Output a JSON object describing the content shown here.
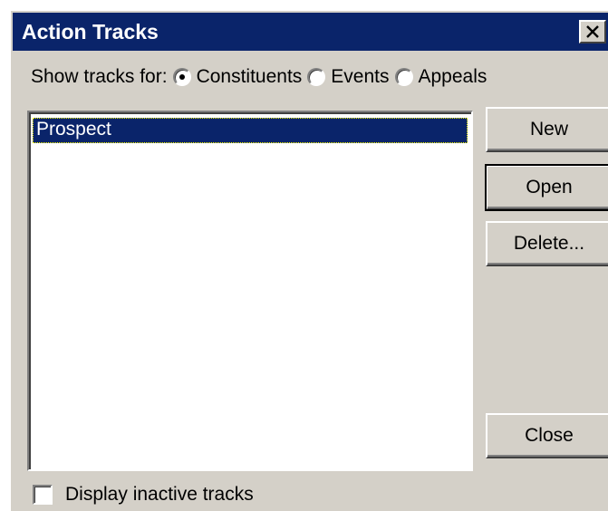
{
  "window": {
    "title": "Action Tracks"
  },
  "show_tracks": {
    "label": "Show tracks for:",
    "options": [
      {
        "label": "Constituents",
        "selected": true
      },
      {
        "label": "Events",
        "selected": false
      },
      {
        "label": "Appeals",
        "selected": false
      }
    ]
  },
  "tracks_list": {
    "items": [
      "Prospect"
    ],
    "selected_index": 0
  },
  "buttons": {
    "new": "New",
    "open": "Open",
    "delete": "Delete...",
    "close": "Close"
  },
  "display_inactive": {
    "label": "Display inactive tracks",
    "checked": false
  },
  "colors": {
    "titlebar": "#0a246a",
    "face": "#d4d0c8",
    "selection": "#0a246a"
  }
}
